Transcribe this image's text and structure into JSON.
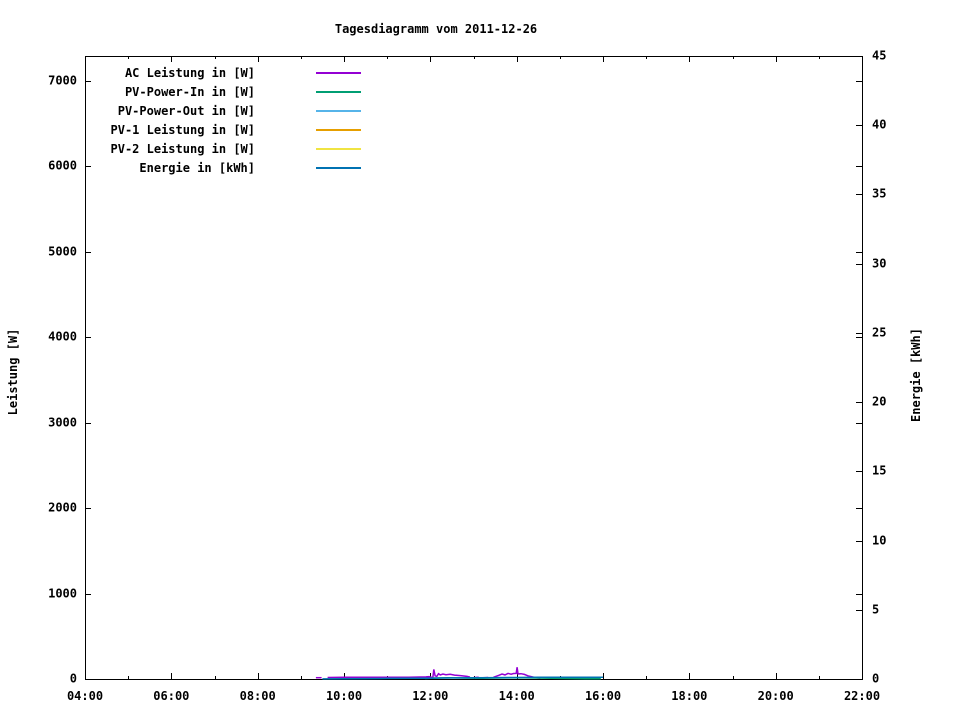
{
  "window": {
    "background": "#ffffff"
  },
  "chart_data": {
    "type": "line",
    "title": "Tagesdiagramm vom 2011-12-26",
    "x_axis": {
      "min_hour": 4,
      "max_hour": 22,
      "major_ticks": [
        {
          "hour": 4,
          "label": "04:00"
        },
        {
          "hour": 6,
          "label": "06:00"
        },
        {
          "hour": 8,
          "label": "08:00"
        },
        {
          "hour": 10,
          "label": "10:00"
        },
        {
          "hour": 12,
          "label": "12:00"
        },
        {
          "hour": 14,
          "label": "14:00"
        },
        {
          "hour": 16,
          "label": "16:00"
        },
        {
          "hour": 18,
          "label": "18:00"
        },
        {
          "hour": 20,
          "label": "20:00"
        },
        {
          "hour": 22,
          "label": "22:00"
        }
      ],
      "minor_tick_hours": [
        5,
        7,
        9,
        11,
        13,
        15,
        17,
        19,
        21
      ]
    },
    "y_left": {
      "label": "Leistung [W]",
      "min": 0,
      "max": 7292,
      "ticks": [
        {
          "v": 0,
          "label": "0"
        },
        {
          "v": 1000,
          "label": "1000"
        },
        {
          "v": 2000,
          "label": "2000"
        },
        {
          "v": 3000,
          "label": "3000"
        },
        {
          "v": 4000,
          "label": "4000"
        },
        {
          "v": 5000,
          "label": "5000"
        },
        {
          "v": 6000,
          "label": "6000"
        },
        {
          "v": 7000,
          "label": "7000"
        }
      ]
    },
    "y_right": {
      "label": "Energie [kWh]",
      "min": 0,
      "max": 45,
      "ticks": [
        {
          "v": 0,
          "label": "0"
        },
        {
          "v": 5,
          "label": "5"
        },
        {
          "v": 10,
          "label": "10"
        },
        {
          "v": 15,
          "label": "15"
        },
        {
          "v": 20,
          "label": "20"
        },
        {
          "v": 25,
          "label": "25"
        },
        {
          "v": 30,
          "label": "30"
        },
        {
          "v": 35,
          "label": "35"
        },
        {
          "v": 40,
          "label": "40"
        },
        {
          "v": 45,
          "label": "45"
        }
      ]
    },
    "legend_position": "top-left-inside",
    "grid": false,
    "series": [
      {
        "name": "AC Leistung in [W]",
        "color": "#9400d3",
        "axis": "left",
        "segments": [
          [
            [
              9.35,
              15
            ],
            [
              9.48,
              15
            ]
          ],
          [
            [
              9.62,
              18
            ],
            [
              10.0,
              20
            ],
            [
              10.5,
              20
            ],
            [
              11.0,
              20
            ],
            [
              11.5,
              20
            ],
            [
              11.9,
              24
            ],
            [
              11.97,
              28
            ],
            [
              12.03,
              20
            ],
            [
              12.06,
              20
            ],
            [
              12.08,
              112
            ],
            [
              12.11,
              38
            ],
            [
              12.15,
              30
            ],
            [
              12.19,
              62
            ],
            [
              12.23,
              48
            ],
            [
              12.29,
              58
            ],
            [
              12.36,
              50
            ],
            [
              12.46,
              55
            ],
            [
              12.56,
              46
            ],
            [
              12.7,
              40
            ],
            [
              12.85,
              30
            ],
            [
              12.92,
              22
            ]
          ],
          [
            [
              13.0,
              16
            ],
            [
              13.12,
              20
            ]
          ],
          [
            [
              13.22,
              14
            ],
            [
              13.34,
              17
            ]
          ],
          [
            [
              13.46,
              20
            ],
            [
              13.58,
              42
            ],
            [
              13.66,
              58
            ],
            [
              13.73,
              48
            ],
            [
              13.8,
              66
            ],
            [
              13.87,
              56
            ],
            [
              13.93,
              64
            ],
            [
              13.99,
              66
            ],
            [
              14.01,
              138
            ],
            [
              14.03,
              60
            ],
            [
              14.1,
              62
            ],
            [
              14.18,
              54
            ],
            [
              14.26,
              38
            ],
            [
              14.36,
              26
            ],
            [
              14.46,
              14
            ],
            [
              14.55,
              8
            ]
          ]
        ]
      },
      {
        "name": "PV-Power-In in [W]",
        "color": "#009e73",
        "axis": "left",
        "segments": [
          [
            [
              11.88,
              6
            ],
            [
              12.1,
              12
            ],
            [
              12.4,
              14
            ],
            [
              12.8,
              10
            ],
            [
              13.2,
              9
            ],
            [
              13.6,
              12
            ],
            [
              14.0,
              14
            ],
            [
              14.4,
              12
            ],
            [
              14.8,
              8
            ],
            [
              15.2,
              6
            ],
            [
              15.6,
              4
            ],
            [
              15.95,
              2
            ]
          ]
        ]
      },
      {
        "name": "PV-Power-Out in [W]",
        "color": "#56b4e9",
        "axis": "left",
        "segments": []
      },
      {
        "name": "PV-1 Leistung in [W]",
        "color": "#e69f00",
        "axis": "left",
        "segments": []
      },
      {
        "name": "PV-2 Leistung in [W]",
        "color": "#f0e442",
        "axis": "left",
        "segments": []
      },
      {
        "name": "Energie in [kWh]",
        "color": "#0072b2",
        "axis": "right",
        "segments": [
          [
            [
              9.5,
              0.01
            ],
            [
              10.0,
              0.02
            ],
            [
              10.5,
              0.03
            ],
            [
              11.0,
              0.04
            ],
            [
              11.5,
              0.05
            ],
            [
              12.0,
              0.06
            ],
            [
              12.5,
              0.08
            ],
            [
              13.0,
              0.09
            ],
            [
              13.5,
              0.1
            ],
            [
              14.0,
              0.11
            ],
            [
              14.5,
              0.12
            ],
            [
              15.0,
              0.12
            ],
            [
              15.5,
              0.12
            ],
            [
              16.0,
              0.12
            ]
          ]
        ]
      }
    ]
  }
}
